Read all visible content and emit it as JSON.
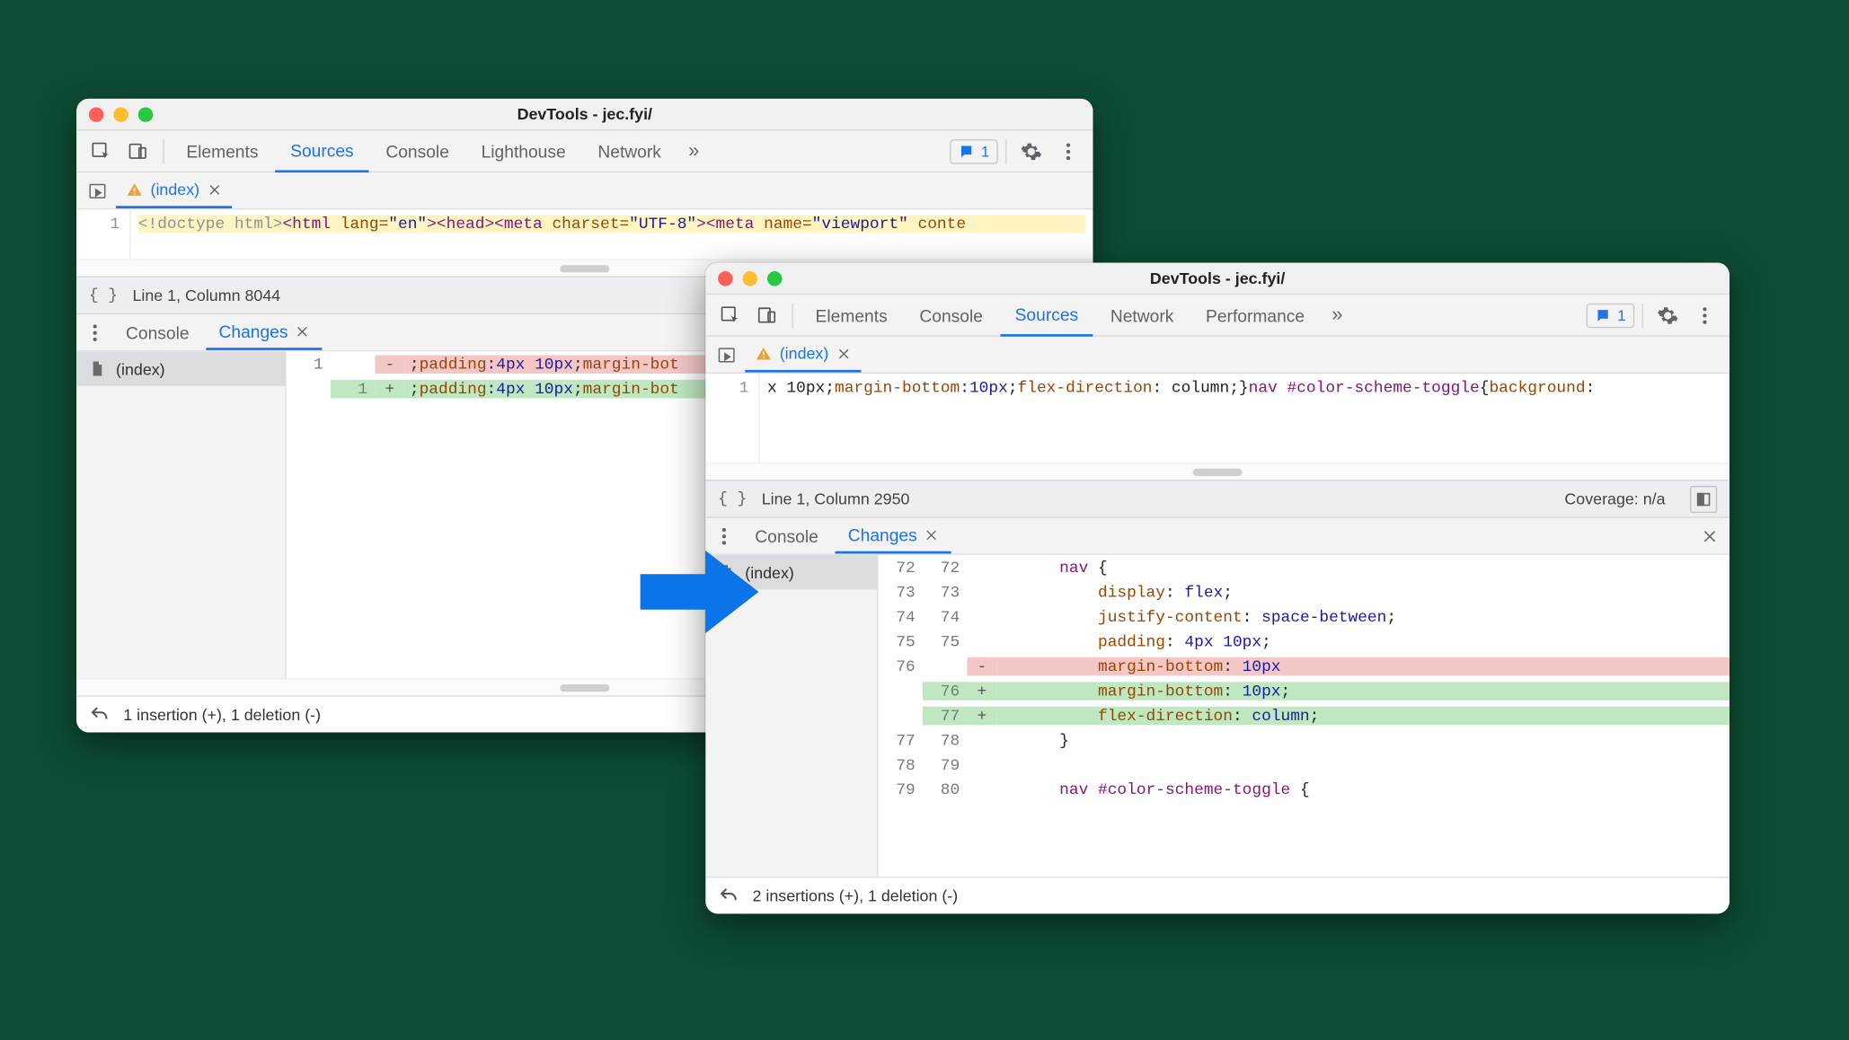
{
  "windows": {
    "a": {
      "title": "DevTools - jec.fyi/",
      "tabs": [
        "Elements",
        "Sources",
        "Console",
        "Lighthouse",
        "Network"
      ],
      "active_tab_index": 1,
      "issues_count": "1",
      "file_tab": {
        "name": "(index)"
      },
      "editor": {
        "line_number": "1",
        "seg_doctype": "<!doctype html>",
        "seg_html_open": "<html ",
        "seg_lang_attr": "lang=",
        "seg_lang_val": "\"en\"",
        "seg_html_close": ">",
        "seg_head": "<head>",
        "seg_meta1": "<meta ",
        "seg_charset_attr": "charset=",
        "seg_charset_val": "\"UTF-8\"",
        "seg_meta1_close": "><meta ",
        "seg_name_attr": "name=",
        "seg_name_val": "\"viewport\"",
        "seg_cont_attr": " conte"
      },
      "status": {
        "position": "Line 1, Column 8044"
      },
      "drawer": {
        "tabs": [
          "Console",
          "Changes"
        ],
        "active_index": 1,
        "file": "(index)",
        "rows": [
          {
            "old": "1",
            "new": "",
            "mark": "-",
            "pre": ";",
            "p1": "padding",
            "v1": ":4px 10px",
            "sep1": ";",
            "p2": "margin-bot"
          },
          {
            "old": "",
            "new": "1",
            "mark": "+",
            "pre": ";",
            "p1": "padding",
            "v1": ":4px 10px",
            "sep1": ";",
            "p2": "margin-bot"
          }
        ],
        "summary": "1 insertion (+), 1 deletion (-)"
      }
    },
    "b": {
      "title": "DevTools - jec.fyi/",
      "tabs": [
        "Elements",
        "Console",
        "Sources",
        "Network",
        "Performance"
      ],
      "active_tab_index": 2,
      "issues_count": "1",
      "file_tab": {
        "name": "(index)"
      },
      "editor": {
        "line_number": "1",
        "seg1": "x 10px",
        "sep1": ";",
        "p1": "margin-bottom",
        "v1": ":10px",
        "sep2": ";",
        "p2": "flex-direction",
        "v2": ": column",
        "sep3": ";}",
        "sel2": "nav #color-scheme-toggle",
        "brace": "{",
        "p3": "background",
        "tail": ":"
      },
      "status": {
        "position": "Line 1, Column 2950",
        "coverage": "Coverage: n/a"
      },
      "drawer": {
        "tabs": [
          "Console",
          "Changes"
        ],
        "active_index": 1,
        "file": "(index)",
        "rows": [
          {
            "o": "72",
            "n": "72",
            "m": "",
            "indent": "      ",
            "type": "sel",
            "t": "nav {"
          },
          {
            "o": "73",
            "n": "73",
            "m": "",
            "indent": "          ",
            "type": "prop",
            "p": "display",
            "v": ": flex;"
          },
          {
            "o": "74",
            "n": "74",
            "m": "",
            "indent": "          ",
            "type": "prop",
            "p": "justify-content",
            "v": ": space-between;"
          },
          {
            "o": "75",
            "n": "75",
            "m": "",
            "indent": "          ",
            "type": "prop",
            "p": "padding",
            "v": ": 4px 10px;"
          },
          {
            "o": "76",
            "n": "",
            "m": "-",
            "indent": "          ",
            "type": "prop",
            "p": "margin-bottom",
            "v": ": 10px",
            "class": "del"
          },
          {
            "o": "",
            "n": "76",
            "m": "+",
            "indent": "          ",
            "type": "prop",
            "p": "margin-bottom",
            "v": ": 10px;",
            "class": "add"
          },
          {
            "o": "",
            "n": "77",
            "m": "+",
            "indent": "          ",
            "type": "prop",
            "p": "flex-direction",
            "v": ": column;",
            "class": "add"
          },
          {
            "o": "77",
            "n": "78",
            "m": "",
            "indent": "      ",
            "type": "plain",
            "t": "}"
          },
          {
            "o": "78",
            "n": "79",
            "m": "",
            "indent": "",
            "type": "plain",
            "t": ""
          },
          {
            "o": "79",
            "n": "80",
            "m": "",
            "indent": "      ",
            "type": "sel",
            "t": "nav #color-scheme-toggle {"
          }
        ],
        "summary": "2 insertions (+), 1 deletion (-)"
      }
    }
  }
}
